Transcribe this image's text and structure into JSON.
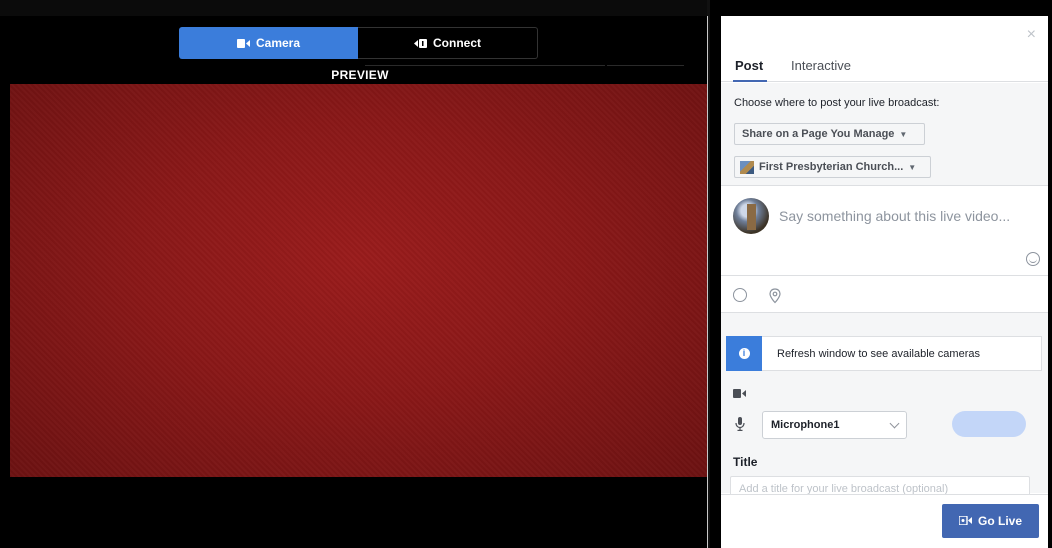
{
  "preview": {
    "mode_camera_label": "Camera",
    "mode_connect_label": "Connect",
    "preview_label": "PREVIEW",
    "feed_color": "#8a1818"
  },
  "panel": {
    "close_label": "×",
    "tabs": [
      {
        "label": "Post",
        "active": true
      },
      {
        "label": "Interactive",
        "active": false
      }
    ],
    "destination": {
      "prompt": "Choose where to post your live broadcast:",
      "share_select": "Share on a Page You Manage",
      "page_select": "First Presbyterian Church..."
    },
    "composer": {
      "placeholder": "Say something about this live video..."
    },
    "notice": {
      "icon": "info-icon",
      "text": "Refresh window to see available cameras"
    },
    "microphone": {
      "selected": "Microphone1"
    },
    "title": {
      "label": "Title",
      "placeholder": "Add a title for your live broadcast (optional)"
    },
    "go_live_label": "Go Live"
  },
  "colors": {
    "accent": "#3b7ddb",
    "brand": "#4267b2",
    "level": "#c3d6f8"
  }
}
